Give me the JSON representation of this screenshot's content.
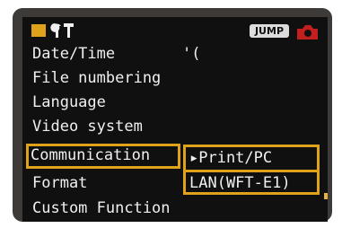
{
  "header": {
    "jump_label": "JUMP",
    "tab_icon_name": "wrench-hammer-icon",
    "camera_icon_name": "camera-icon"
  },
  "menu": {
    "items": [
      {
        "label": "Date/Time"
      },
      {
        "label": "File numbering"
      },
      {
        "label": "Language"
      },
      {
        "label": "Video system"
      },
      {
        "label": "Communication"
      },
      {
        "label": "Format"
      },
      {
        "label": "Custom Function"
      }
    ],
    "selected_index": 4,
    "date_time_value": "'("
  },
  "submenu": {
    "options": [
      {
        "label": "▸Print/PC",
        "selected": true
      },
      {
        "label": "LAN(WFT-E1)",
        "selected": false
      }
    ]
  },
  "colors": {
    "accent": "#e1a21b",
    "background": "#101010",
    "text": "#f0f0f0",
    "camera_red": "#c41f1f",
    "scroll_red": "#a53a2a",
    "scroll_blue": "#2b43a3"
  }
}
